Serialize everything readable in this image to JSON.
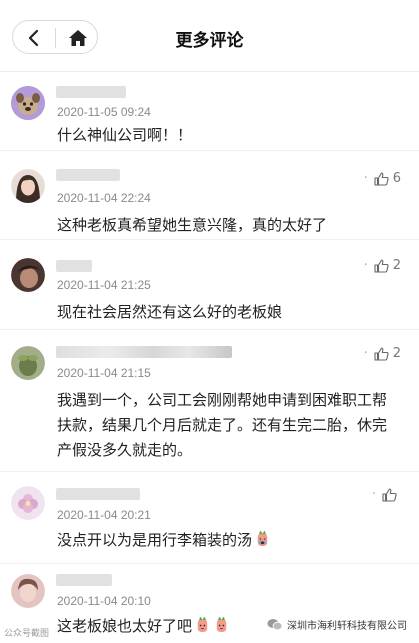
{
  "header": {
    "title": "更多评论"
  },
  "comments": [
    {
      "timestamp": "2020-11-05 09:24",
      "text": "什么神仙公司啊！！",
      "likes": "",
      "avatar_color": "#b39bd8"
    },
    {
      "timestamp": "2020-11-04 22:24",
      "text": "这种老板真希望她生意兴隆，真的太好了",
      "likes": "6",
      "avatar_color": "#5a4a44"
    },
    {
      "timestamp": "2020-11-04 21:25",
      "text": "现在社会居然还有这么好的老板娘",
      "likes": "2",
      "avatar_color": "#6b4a3e"
    },
    {
      "timestamp": "2020-11-04 21:15",
      "text": "我遇到一个，公司工会刚刚帮她申请到困难职工帮扶款，结果几个月后就走了。还有生完二胎，休完产假没多久就走的。",
      "likes": "2",
      "avatar_color": "#8f9a72"
    },
    {
      "timestamp": "2020-11-04 20:21",
      "text": "没点开以为是用行李箱装的汤",
      "likes": "",
      "avatar_color": "#e8d6ea"
    },
    {
      "timestamp": "2020-11-04 20:10",
      "text": "这老板娘也太好了吧",
      "likes": "",
      "avatar_color": "#c9a09a"
    }
  ],
  "watermark": {
    "left": "公众号截图",
    "right": "深圳市海利轩科技有限公司"
  },
  "colors": {
    "emoji_red": "#e94b3c",
    "emoji_green": "#56b04a"
  }
}
